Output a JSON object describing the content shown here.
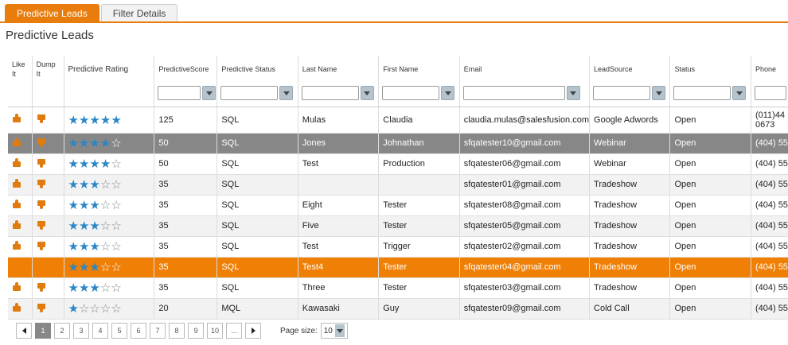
{
  "tabs": [
    {
      "label": "Predictive Leads",
      "active": true
    },
    {
      "label": "Filter Details",
      "active": false
    }
  ],
  "page_title": "Predictive Leads",
  "columns": {
    "like": "Like It",
    "dump": "Dump It",
    "rating": "Predictive Rating",
    "score": "PredictiveScore",
    "status": "Predictive Status",
    "last": "Last Name",
    "first": "First Name",
    "email": "Email",
    "source": "LeadSource",
    "lstatus": "Status",
    "phone": "Phone"
  },
  "rows": [
    {
      "rating": 5,
      "score": "125",
      "pstatus": "SQL",
      "last": "Mulas",
      "first": "Claudia",
      "email": "claudia.mulas@salesfusion.com",
      "source": "Google Adwords",
      "status": "Open",
      "phone": "(011)44",
      "phone2": "0673",
      "style": "tall",
      "thumbs": true
    },
    {
      "rating": 4,
      "score": "50",
      "pstatus": "SQL",
      "last": "Jones",
      "first": "Johnathan",
      "email": "sfqatester10@gmail.com",
      "source": "Webinar",
      "status": "Open",
      "phone": "(404) 55",
      "style": "sel-gray",
      "thumbs": true
    },
    {
      "rating": 4,
      "score": "50",
      "pstatus": "SQL",
      "last": "Test",
      "first": "Production",
      "email": "sfqatester06@gmail.com",
      "source": "Webinar",
      "status": "Open",
      "phone": "(404) 55",
      "style": "",
      "thumbs": true
    },
    {
      "rating": 3,
      "score": "35",
      "pstatus": "SQL",
      "last": "",
      "first": "",
      "email": "sfqatester01@gmail.com",
      "source": "Tradeshow",
      "status": "Open",
      "phone": "(404) 55",
      "style": "alt",
      "thumbs": true
    },
    {
      "rating": 3,
      "score": "35",
      "pstatus": "SQL",
      "last": "Eight",
      "first": "Tester",
      "email": "sfqatester08@gmail.com",
      "source": "Tradeshow",
      "status": "Open",
      "phone": "(404) 55",
      "style": "",
      "thumbs": true
    },
    {
      "rating": 3,
      "score": "35",
      "pstatus": "SQL",
      "last": "Five",
      "first": "Tester",
      "email": "sfqatester05@gmail.com",
      "source": "Tradeshow",
      "status": "Open",
      "phone": "(404) 55",
      "style": "alt",
      "thumbs": true
    },
    {
      "rating": 3,
      "score": "35",
      "pstatus": "SQL",
      "last": "Test",
      "first": "Trigger",
      "email": "sfqatester02@gmail.com",
      "source": "Tradeshow",
      "status": "Open",
      "phone": "(404) 55",
      "style": "",
      "thumbs": true
    },
    {
      "rating": 3,
      "score": "35",
      "pstatus": "SQL",
      "last": "Test4",
      "first": "Tester",
      "email": "sfqatester04@gmail.com",
      "source": "Tradeshow",
      "status": "Open",
      "phone": "(404) 55",
      "style": "sel-orange",
      "thumbs": false
    },
    {
      "rating": 3,
      "score": "35",
      "pstatus": "SQL",
      "last": "Three",
      "first": "Tester",
      "email": "sfqatester03@gmail.com",
      "source": "Tradeshow",
      "status": "Open",
      "phone": "(404) 55",
      "style": "",
      "thumbs": true
    },
    {
      "rating": 1,
      "score": "20",
      "pstatus": "MQL",
      "last": "Kawasaki",
      "first": "Guy",
      "email": "sfqatester09@gmail.com",
      "source": "Cold Call",
      "status": "Open",
      "phone": "(404) 55",
      "style": "alt",
      "thumbs": true
    }
  ],
  "pager": {
    "pages": [
      "1",
      "2",
      "3",
      "4",
      "5",
      "6",
      "7",
      "8",
      "9",
      "10",
      "..."
    ],
    "current": "1",
    "page_size_label": "Page size:",
    "page_size": "10"
  },
  "colors": {
    "accent": "#e87d0d",
    "star": "#2a86c5",
    "selected_gray": "#878787",
    "selected_orange": "#ef7f05"
  }
}
